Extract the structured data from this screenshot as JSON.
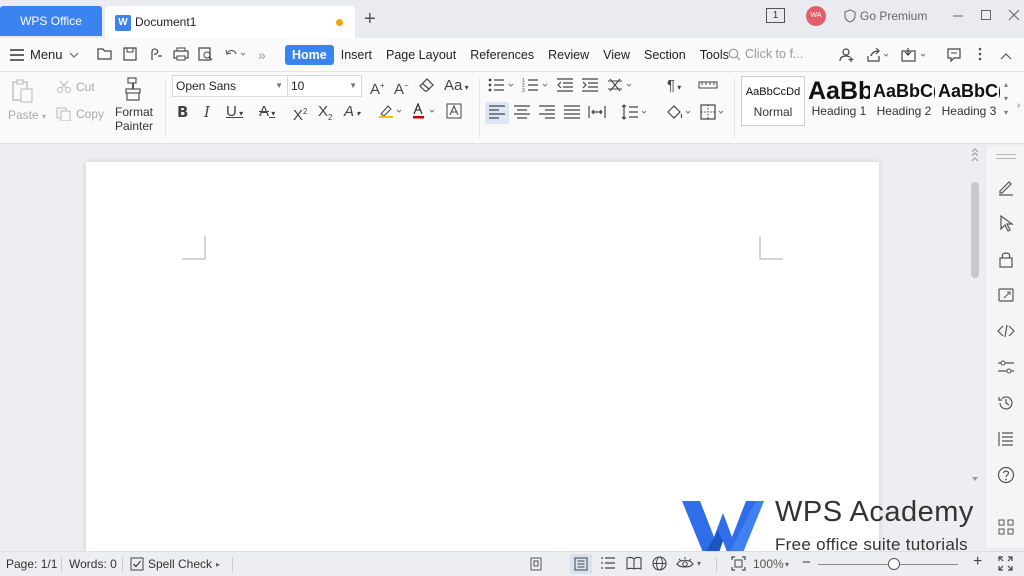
{
  "titlebar": {
    "app_tab": "WPS Office",
    "doc_tab": "Document1",
    "doc_icon": "W",
    "new_tab": "+",
    "window_count": "1",
    "avatar_initials": "WA",
    "premium": "Go Premium"
  },
  "menu": {
    "menu_label": "Menu",
    "tabs": [
      "Home",
      "Insert",
      "Page Layout",
      "References",
      "Review",
      "View",
      "Section",
      "Tools"
    ],
    "active_tab": "Home",
    "search_placeholder": "Click to f..."
  },
  "ribbon": {
    "paste": "Paste",
    "cut": "Cut",
    "copy": "Copy",
    "format_painter_1": "Format",
    "format_painter_2": "Painter",
    "font_name": "Open Sans",
    "font_size": "10",
    "styles": [
      {
        "preview": "AaBbCcDd",
        "label": "Normal"
      },
      {
        "preview": "AaBb",
        "label": "Heading 1"
      },
      {
        "preview": "AaBbC(",
        "label": "Heading 2"
      },
      {
        "preview": "AaBbC(",
        "label": "Heading 3"
      }
    ]
  },
  "watermark": {
    "title": "WPS Academy",
    "subtitle": "Free office suite tutorials"
  },
  "status": {
    "page": "Page: 1/1",
    "words": "Words: 0",
    "spell_check": "Spell Check",
    "zoom": "100%",
    "zoom_minus": "−",
    "zoom_plus": "+"
  },
  "colors": {
    "accent": "#3b83f0",
    "unsaved_dot": "#f0a30a",
    "avatar": "#e45d6a"
  }
}
